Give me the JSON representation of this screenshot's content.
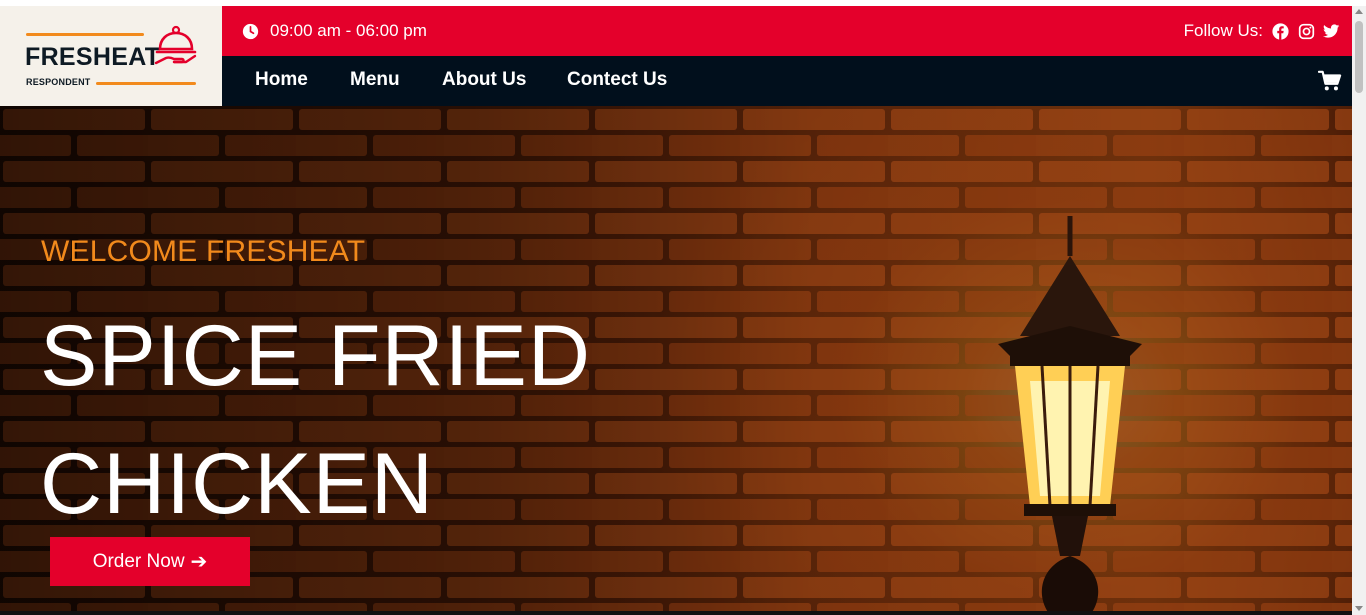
{
  "logo": {
    "name": "FRESHEAT",
    "tagline": "RESPONDENT",
    "icon": "serving-cloche-hand-icon"
  },
  "topbar": {
    "hours": "09:00 am - 06:00 pm",
    "follow_label": "Follow Us:",
    "social": [
      "facebook-icon",
      "instagram-icon",
      "twitter-icon"
    ]
  },
  "nav": {
    "items": [
      "Home",
      "Menu",
      "About Us",
      "Contect Us"
    ],
    "cart_icon": "cart-icon"
  },
  "hero": {
    "welcome": "WELCOME FRESHEAT",
    "headline_line1": "SPICE FRIED",
    "headline_line2": "CHICKEN",
    "button_label": "Order Now",
    "button_icon": "arrow-right-icon"
  },
  "colors": {
    "brand_red": "#e4002b",
    "nav_dark": "#010f1c",
    "accent_orange": "#f28a1c",
    "logo_bg": "#f5f1ea"
  }
}
